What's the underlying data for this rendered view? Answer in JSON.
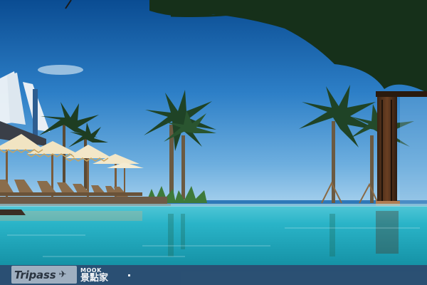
{
  "watermark": {
    "brand": "Tripass",
    "plane_icon": "plane-icon",
    "publisher_en": "MOOK",
    "publisher_zh": "景點家"
  },
  "scene": {
    "sky_color": "#0b57a3",
    "horizon_color": "#8fc2e4",
    "pool_color": "#1fb6c9",
    "umbrella_color": "#f1e4c2"
  }
}
